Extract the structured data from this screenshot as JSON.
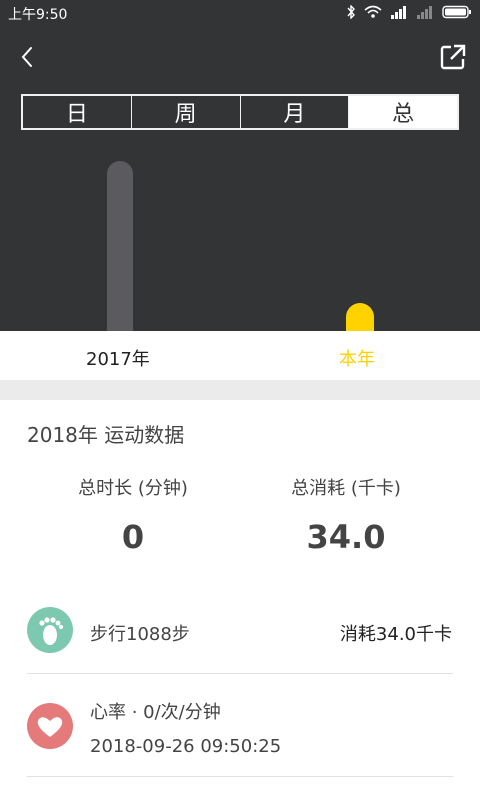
{
  "status": {
    "time": "上午9:50"
  },
  "tabs": [
    "日",
    "周",
    "月",
    "总"
  ],
  "active_tab": 3,
  "chart_data": {
    "type": "bar",
    "categories": [
      "2017年",
      "本年"
    ],
    "highlight_category": "本年",
    "colors": {
      "default": "#5b5a5e",
      "highlight": "#ffd200"
    },
    "values": [
      170,
      28
    ]
  },
  "summary": {
    "title": "2018年   运动数据",
    "duration_label": "总时长 (分钟)",
    "duration_value": "0",
    "calories_label": "总消耗 (千卡)",
    "calories_value": "34.0"
  },
  "records": {
    "steps": {
      "text": "步行1088步",
      "calories": "消耗34.0千卡"
    },
    "heart": {
      "text": "心率  ·  0/次/分钟",
      "time": "2018-09-26 09:50:25"
    }
  },
  "colors": {
    "dark_bg": "#323435",
    "accent": "#ffd200",
    "steps": "#7dc9b0",
    "heart": "#e47a7a"
  },
  "icons": {
    "back": "chevron-left-icon",
    "share": "share-icon",
    "steps": "footprint-icon",
    "heart": "heart-icon"
  }
}
